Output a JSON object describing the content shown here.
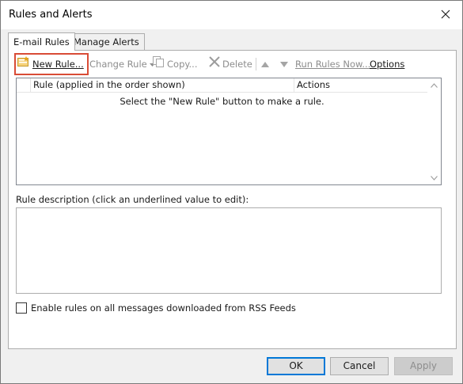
{
  "window": {
    "title": "Rules and Alerts"
  },
  "tabs": [
    {
      "label": "E-mail Rules",
      "active": true
    },
    {
      "label": "Manage Alerts",
      "active": false
    }
  ],
  "toolbar": {
    "new_rule": "New Rule...",
    "change_rule": "Change Rule",
    "copy": "Copy...",
    "delete": "Delete",
    "run_rules_now": "Run Rules Now...",
    "options": "Options"
  },
  "rules_list": {
    "columns": [
      "Rule (applied in the order shown)",
      "Actions"
    ],
    "empty_message": "Select the \"New Rule\" button to make a rule."
  },
  "description": {
    "label": "Rule description (click an underlined value to edit):"
  },
  "rss": {
    "label": "Enable rules on all messages downloaded from RSS Feeds",
    "checked": false
  },
  "buttons": {
    "ok": "OK",
    "cancel": "Cancel",
    "apply": "Apply"
  },
  "colors": {
    "highlight_border": "#d94c36",
    "default_button_border": "#0078d7"
  }
}
